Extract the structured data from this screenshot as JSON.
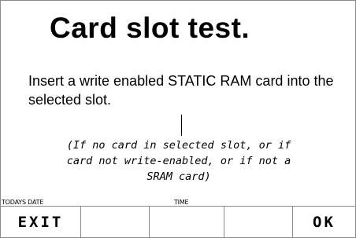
{
  "screen": {
    "title": "Card slot test.",
    "instruction": "Insert a write enabled STATIC RAM card into the selected slot.",
    "note_lines": [
      "(If no card in selected slot, or if",
      "card not write-enabled, or if not a",
      "SRAM card)"
    ]
  },
  "status": {
    "date_label": "TODAYS DATE",
    "time_label": "TIME"
  },
  "softkeys": {
    "key1": "EXIT",
    "key2": "",
    "key3": "",
    "key4": "",
    "key5": "OK"
  }
}
